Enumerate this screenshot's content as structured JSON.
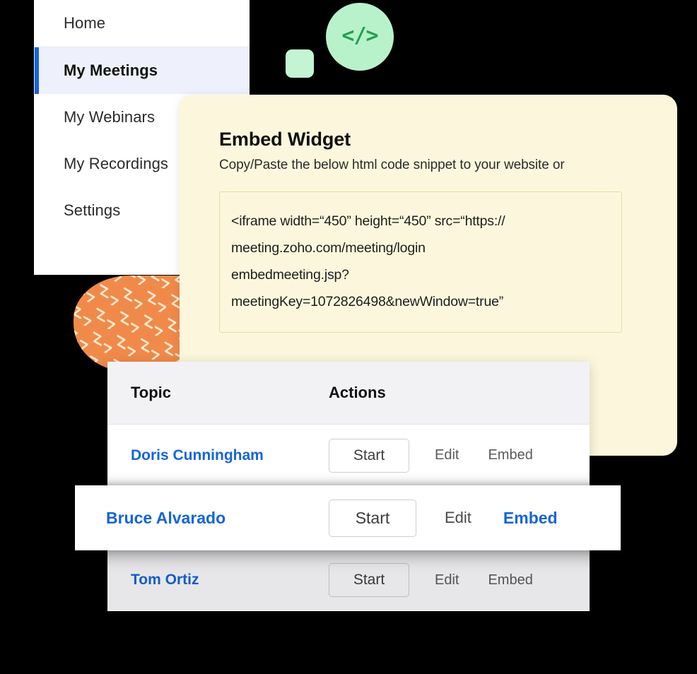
{
  "decor": {
    "code_badge_glyph": "</>",
    "code_badge_name": "code-icon",
    "accent_green": "#B8F2CB",
    "accent_green_dark": "#22A050",
    "accent_orange": "#F08A4B",
    "accent_blue": "#1565D8",
    "card_cream": "#FCF7DC"
  },
  "sidebar": {
    "items": [
      {
        "label": "Home",
        "active": false
      },
      {
        "label": "My Meetings",
        "active": true
      },
      {
        "label": "My Webinars",
        "active": false
      },
      {
        "label": "My Recordings",
        "active": false
      },
      {
        "label": "Settings",
        "active": false
      }
    ]
  },
  "embed_widget": {
    "title": "Embed Widget",
    "subtitle": "Copy/Paste the below html code snippet to your website or",
    "code_lines": [
      "<iframe width=“450” height=“450” src=“https://",
      "meeting.zoho.com/meeting/login",
      "embedmeeting.jsp?",
      "meetingKey=1072826498&newWindow=true”"
    ]
  },
  "meetings_table": {
    "columns": [
      "Topic",
      "Actions"
    ],
    "rows": [
      {
        "topic": "Doris Cunningham",
        "start_label": "Start",
        "edit_label": "Edit",
        "embed_label": "Embed",
        "highlighted": false
      },
      {
        "topic": "Bruce Alvarado",
        "start_label": "Start",
        "edit_label": "Edit",
        "embed_label": "Embed",
        "highlighted": true
      },
      {
        "topic": "Tom Ortiz",
        "start_label": "Start",
        "edit_label": "Edit",
        "embed_label": "Embed",
        "highlighted": false
      }
    ]
  }
}
